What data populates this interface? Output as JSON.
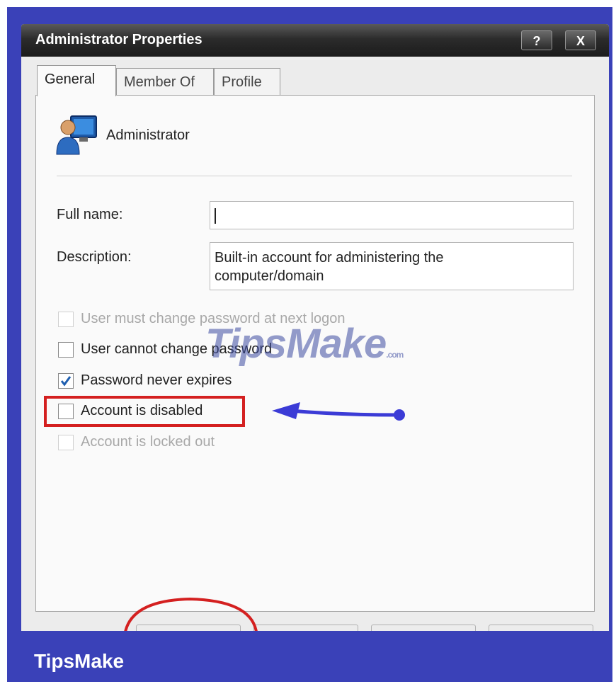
{
  "window": {
    "title": "Administrator Properties",
    "help_label": "?",
    "close_label": "X"
  },
  "tabs": [
    "General",
    "Member Of",
    "Profile"
  ],
  "user": {
    "name": "Administrator"
  },
  "form": {
    "full_name_label": "Full name:",
    "full_name_value": "",
    "description_label": "Description:",
    "description_value": "Built-in account for administering the computer/domain"
  },
  "checkboxes": [
    {
      "label": "User must change password at next logon",
      "checked": false,
      "enabled": false
    },
    {
      "label": "User cannot change password",
      "checked": false,
      "enabled": true
    },
    {
      "label": "Password never expires",
      "checked": true,
      "enabled": true
    },
    {
      "label": "Account is disabled",
      "checked": false,
      "enabled": true
    },
    {
      "label": "Account is locked out",
      "checked": false,
      "enabled": false
    }
  ],
  "watermark": {
    "text": "TipsMake",
    "suffix": ".com"
  },
  "branding": {
    "label": "TipsMake"
  },
  "colors": {
    "frame": "#3a41b8",
    "highlight": "#d42020",
    "arrow": "#3b3bd6",
    "check": "#1f5fb0"
  }
}
